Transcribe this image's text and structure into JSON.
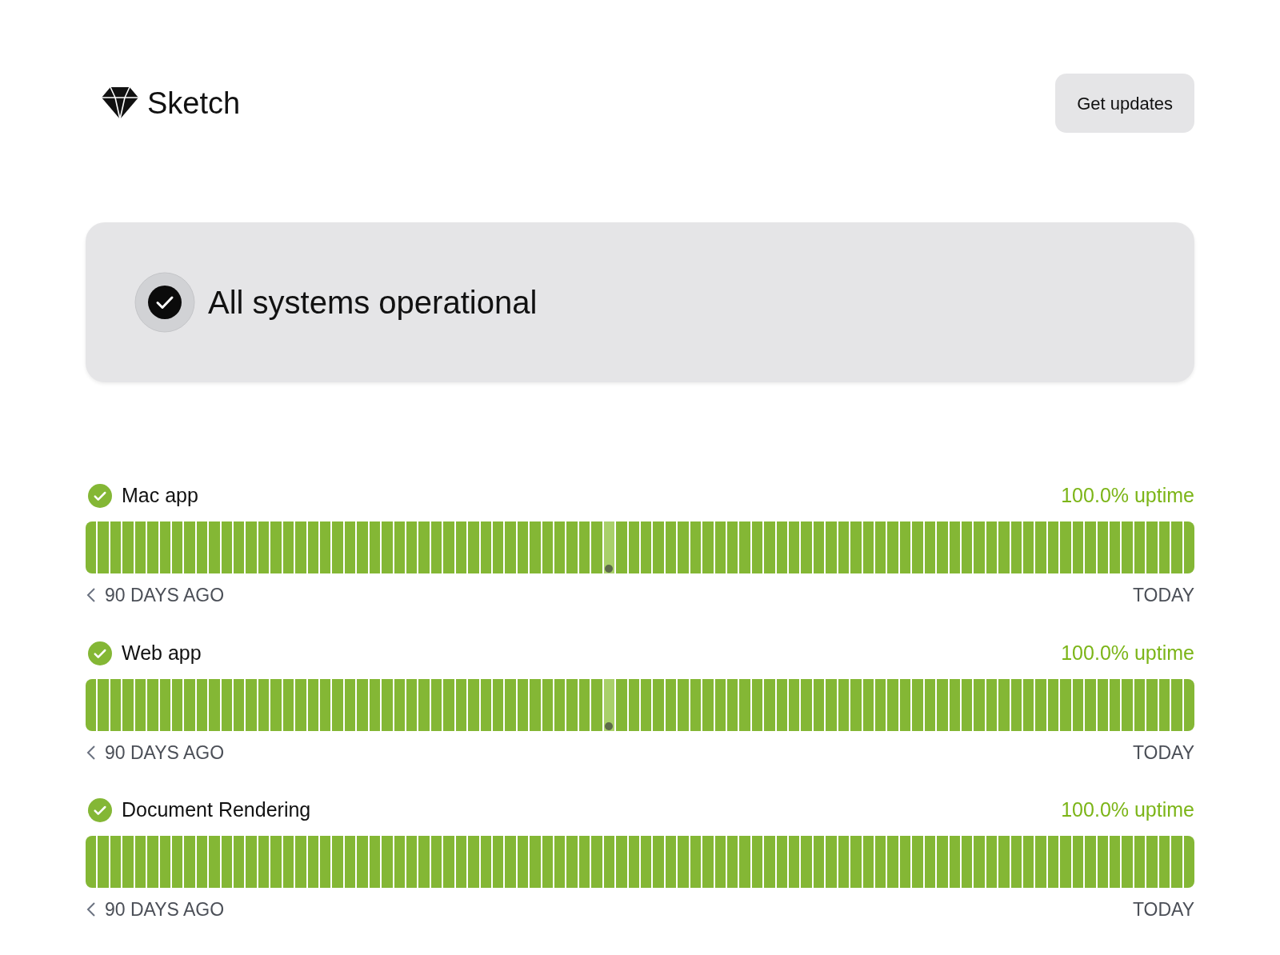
{
  "header": {
    "logo": "Sketch",
    "button": "Get updates"
  },
  "status": {
    "title": "All systems operational"
  },
  "services": [
    {
      "name": "Mac app",
      "uptime": "100.0% uptime",
      "start": "90 DAYS AGO",
      "end": "TODAY",
      "days": [
        {
          "selected": false
        },
        {
          "selected": false
        },
        {
          "selected": false
        },
        {
          "selected": false
        },
        {
          "selected": false
        },
        {
          "selected": false
        },
        {
          "selected": false
        },
        {
          "selected": false
        },
        {
          "selected": false
        },
        {
          "selected": false
        },
        {
          "selected": false
        },
        {
          "selected": false
        },
        {
          "selected": false
        },
        {
          "selected": false
        },
        {
          "selected": false
        },
        {
          "selected": false
        },
        {
          "selected": false
        },
        {
          "selected": false
        },
        {
          "selected": false
        },
        {
          "selected": false
        },
        {
          "selected": false
        },
        {
          "selected": false
        },
        {
          "selected": false
        },
        {
          "selected": false
        },
        {
          "selected": false
        },
        {
          "selected": false
        },
        {
          "selected": false
        },
        {
          "selected": false
        },
        {
          "selected": false
        },
        {
          "selected": false
        },
        {
          "selected": false
        },
        {
          "selected": false
        },
        {
          "selected": false
        },
        {
          "selected": false
        },
        {
          "selected": false
        },
        {
          "selected": false
        },
        {
          "selected": false
        },
        {
          "selected": false
        },
        {
          "selected": false
        },
        {
          "selected": false
        },
        {
          "selected": false
        },
        {
          "selected": false
        },
        {
          "selected": true
        },
        {
          "selected": false
        },
        {
          "selected": false
        },
        {
          "selected": false
        },
        {
          "selected": false
        },
        {
          "selected": false
        },
        {
          "selected": false
        },
        {
          "selected": false
        },
        {
          "selected": false
        },
        {
          "selected": false
        },
        {
          "selected": false
        },
        {
          "selected": false
        },
        {
          "selected": false
        },
        {
          "selected": false
        },
        {
          "selected": false
        },
        {
          "selected": false
        },
        {
          "selected": false
        },
        {
          "selected": false
        },
        {
          "selected": false
        },
        {
          "selected": false
        },
        {
          "selected": false
        },
        {
          "selected": false
        },
        {
          "selected": false
        },
        {
          "selected": false
        },
        {
          "selected": false
        },
        {
          "selected": false
        },
        {
          "selected": false
        },
        {
          "selected": false
        },
        {
          "selected": false
        },
        {
          "selected": false
        },
        {
          "selected": false
        },
        {
          "selected": false
        },
        {
          "selected": false
        },
        {
          "selected": false
        },
        {
          "selected": false
        },
        {
          "selected": false
        },
        {
          "selected": false
        },
        {
          "selected": false
        },
        {
          "selected": false
        },
        {
          "selected": false
        },
        {
          "selected": false
        },
        {
          "selected": false
        },
        {
          "selected": false
        },
        {
          "selected": false
        },
        {
          "selected": false
        },
        {
          "selected": false
        },
        {
          "selected": false
        },
        {
          "selected": false
        }
      ]
    },
    {
      "name": "Web app",
      "uptime": "100.0% uptime",
      "start": "90 DAYS AGO",
      "end": "TODAY",
      "days": [
        {
          "selected": false
        },
        {
          "selected": false
        },
        {
          "selected": false
        },
        {
          "selected": false
        },
        {
          "selected": false
        },
        {
          "selected": false
        },
        {
          "selected": false
        },
        {
          "selected": false
        },
        {
          "selected": false
        },
        {
          "selected": false
        },
        {
          "selected": false
        },
        {
          "selected": false
        },
        {
          "selected": false
        },
        {
          "selected": false
        },
        {
          "selected": false
        },
        {
          "selected": false
        },
        {
          "selected": false
        },
        {
          "selected": false
        },
        {
          "selected": false
        },
        {
          "selected": false
        },
        {
          "selected": false
        },
        {
          "selected": false
        },
        {
          "selected": false
        },
        {
          "selected": false
        },
        {
          "selected": false
        },
        {
          "selected": false
        },
        {
          "selected": false
        },
        {
          "selected": false
        },
        {
          "selected": false
        },
        {
          "selected": false
        },
        {
          "selected": false
        },
        {
          "selected": false
        },
        {
          "selected": false
        },
        {
          "selected": false
        },
        {
          "selected": false
        },
        {
          "selected": false
        },
        {
          "selected": false
        },
        {
          "selected": false
        },
        {
          "selected": false
        },
        {
          "selected": false
        },
        {
          "selected": false
        },
        {
          "selected": false
        },
        {
          "selected": true
        },
        {
          "selected": false
        },
        {
          "selected": false
        },
        {
          "selected": false
        },
        {
          "selected": false
        },
        {
          "selected": false
        },
        {
          "selected": false
        },
        {
          "selected": false
        },
        {
          "selected": false
        },
        {
          "selected": false
        },
        {
          "selected": false
        },
        {
          "selected": false
        },
        {
          "selected": false
        },
        {
          "selected": false
        },
        {
          "selected": false
        },
        {
          "selected": false
        },
        {
          "selected": false
        },
        {
          "selected": false
        },
        {
          "selected": false
        },
        {
          "selected": false
        },
        {
          "selected": false
        },
        {
          "selected": false
        },
        {
          "selected": false
        },
        {
          "selected": false
        },
        {
          "selected": false
        },
        {
          "selected": false
        },
        {
          "selected": false
        },
        {
          "selected": false
        },
        {
          "selected": false
        },
        {
          "selected": false
        },
        {
          "selected": false
        },
        {
          "selected": false
        },
        {
          "selected": false
        },
        {
          "selected": false
        },
        {
          "selected": false
        },
        {
          "selected": false
        },
        {
          "selected": false
        },
        {
          "selected": false
        },
        {
          "selected": false
        },
        {
          "selected": false
        },
        {
          "selected": false
        },
        {
          "selected": false
        },
        {
          "selected": false
        },
        {
          "selected": false
        },
        {
          "selected": false
        },
        {
          "selected": false
        },
        {
          "selected": false
        },
        {
          "selected": false
        }
      ]
    },
    {
      "name": "Document Rendering",
      "uptime": "100.0% uptime",
      "start": "90 DAYS AGO",
      "end": "TODAY",
      "days": [
        {
          "selected": false
        },
        {
          "selected": false
        },
        {
          "selected": false
        },
        {
          "selected": false
        },
        {
          "selected": false
        },
        {
          "selected": false
        },
        {
          "selected": false
        },
        {
          "selected": false
        },
        {
          "selected": false
        },
        {
          "selected": false
        },
        {
          "selected": false
        },
        {
          "selected": false
        },
        {
          "selected": false
        },
        {
          "selected": false
        },
        {
          "selected": false
        },
        {
          "selected": false
        },
        {
          "selected": false
        },
        {
          "selected": false
        },
        {
          "selected": false
        },
        {
          "selected": false
        },
        {
          "selected": false
        },
        {
          "selected": false
        },
        {
          "selected": false
        },
        {
          "selected": false
        },
        {
          "selected": false
        },
        {
          "selected": false
        },
        {
          "selected": false
        },
        {
          "selected": false
        },
        {
          "selected": false
        },
        {
          "selected": false
        },
        {
          "selected": false
        },
        {
          "selected": false
        },
        {
          "selected": false
        },
        {
          "selected": false
        },
        {
          "selected": false
        },
        {
          "selected": false
        },
        {
          "selected": false
        },
        {
          "selected": false
        },
        {
          "selected": false
        },
        {
          "selected": false
        },
        {
          "selected": false
        },
        {
          "selected": false
        },
        {
          "selected": false
        },
        {
          "selected": false
        },
        {
          "selected": false
        },
        {
          "selected": false
        },
        {
          "selected": false
        },
        {
          "selected": false
        },
        {
          "selected": false
        },
        {
          "selected": false
        },
        {
          "selected": false
        },
        {
          "selected": false
        },
        {
          "selected": false
        },
        {
          "selected": false
        },
        {
          "selected": false
        },
        {
          "selected": false
        },
        {
          "selected": false
        },
        {
          "selected": false
        },
        {
          "selected": false
        },
        {
          "selected": false
        },
        {
          "selected": false
        },
        {
          "selected": false
        },
        {
          "selected": false
        },
        {
          "selected": false
        },
        {
          "selected": false
        },
        {
          "selected": false
        },
        {
          "selected": false
        },
        {
          "selected": false
        },
        {
          "selected": false
        },
        {
          "selected": false
        },
        {
          "selected": false
        },
        {
          "selected": false
        },
        {
          "selected": false
        },
        {
          "selected": false
        },
        {
          "selected": false
        },
        {
          "selected": false
        },
        {
          "selected": false
        },
        {
          "selected": false
        },
        {
          "selected": false
        },
        {
          "selected": false
        },
        {
          "selected": false
        },
        {
          "selected": false
        },
        {
          "selected": false
        },
        {
          "selected": false
        },
        {
          "selected": false
        },
        {
          "selected": false
        },
        {
          "selected": false
        },
        {
          "selected": false
        },
        {
          "selected": false
        },
        {
          "selected": false
        }
      ]
    }
  ]
}
